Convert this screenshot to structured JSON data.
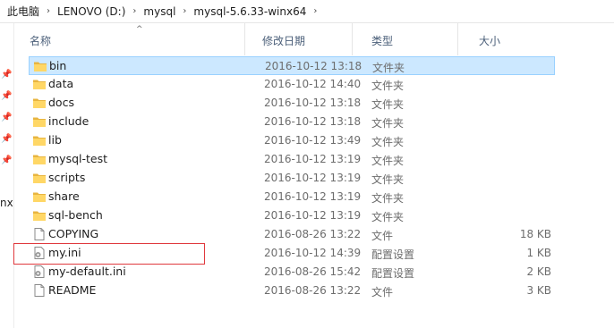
{
  "breadcrumb": [
    "此电脑",
    "LENOVO (D:)",
    "mysql",
    "mysql-5.6.33-winx64"
  ],
  "nav_cut_text": "nx",
  "columns": {
    "name": "名称",
    "date": "修改日期",
    "type": "类型",
    "size": "大小"
  },
  "files": [
    {
      "name": "bin",
      "date": "2016-10-12 13:18",
      "type": "文件夹",
      "size": "",
      "kind": "folder",
      "selected": true
    },
    {
      "name": "data",
      "date": "2016-10-12 14:40",
      "type": "文件夹",
      "size": "",
      "kind": "folder"
    },
    {
      "name": "docs",
      "date": "2016-10-12 13:18",
      "type": "文件夹",
      "size": "",
      "kind": "folder"
    },
    {
      "name": "include",
      "date": "2016-10-12 13:18",
      "type": "文件夹",
      "size": "",
      "kind": "folder"
    },
    {
      "name": "lib",
      "date": "2016-10-12 13:49",
      "type": "文件夹",
      "size": "",
      "kind": "folder"
    },
    {
      "name": "mysql-test",
      "date": "2016-10-12 13:19",
      "type": "文件夹",
      "size": "",
      "kind": "folder"
    },
    {
      "name": "scripts",
      "date": "2016-10-12 13:19",
      "type": "文件夹",
      "size": "",
      "kind": "folder"
    },
    {
      "name": "share",
      "date": "2016-10-12 13:19",
      "type": "文件夹",
      "size": "",
      "kind": "folder"
    },
    {
      "name": "sql-bench",
      "date": "2016-10-12 13:19",
      "type": "文件夹",
      "size": "",
      "kind": "folder"
    },
    {
      "name": "COPYING",
      "date": "2016-08-26 13:22",
      "type": "文件",
      "size": "18 KB",
      "kind": "file"
    },
    {
      "name": "my.ini",
      "date": "2016-10-12 14:39",
      "type": "配置设置",
      "size": "1 KB",
      "kind": "config"
    },
    {
      "name": "my-default.ini",
      "date": "2016-08-26 15:42",
      "type": "配置设置",
      "size": "2 KB",
      "kind": "config"
    },
    {
      "name": "README",
      "date": "2016-08-26 13:22",
      "type": "文件",
      "size": "3 KB",
      "kind": "file"
    }
  ]
}
